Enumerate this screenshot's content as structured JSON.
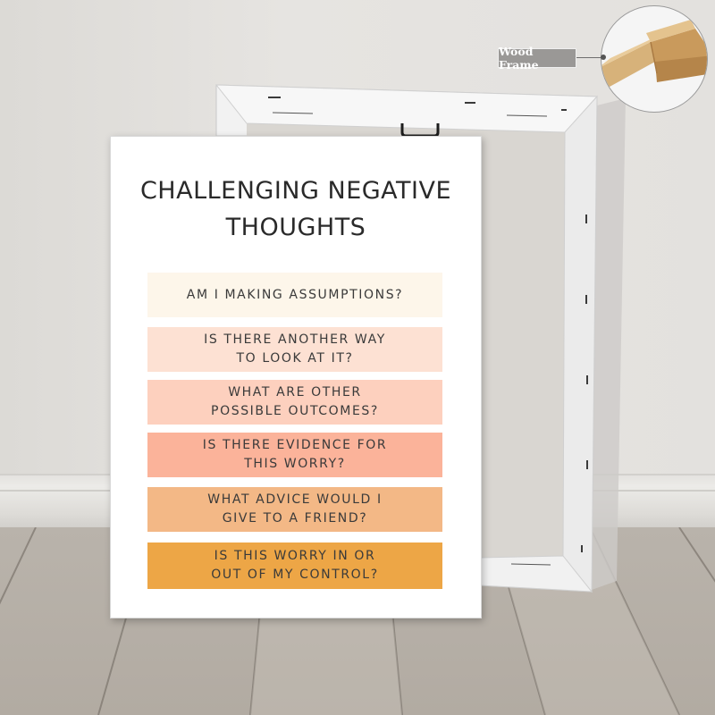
{
  "poster": {
    "title": "CHALLENGING NEGATIVE\nTHOUGHTS",
    "items": [
      {
        "text": "AM I MAKING ASSUMPTIONS?",
        "color": "#fdf6ea"
      },
      {
        "text": "IS THERE ANOTHER WAY\nTO LOOK AT IT?",
        "color": "#fde1d3"
      },
      {
        "text": "WHAT ARE OTHER\nPOSSIBLE OUTCOMES?",
        "color": "#fdd0be"
      },
      {
        "text": "IS THERE EVIDENCE FOR\nTHIS WORRY?",
        "color": "#fbb39a"
      },
      {
        "text": "WHAT ADVICE WOULD I\nGIVE TO A FRIEND?",
        "color": "#f3b886"
      },
      {
        "text": "IS THIS WORRY IN OR\nOUT OF MY CONTROL?",
        "color": "#eda646"
      }
    ]
  },
  "callout": {
    "label": "Wood Frame",
    "wood_color": "#dcb67f"
  },
  "colors": {
    "wall": "#e3e1de",
    "floor": "#b5aea5",
    "frame": "#f4f4f4"
  }
}
